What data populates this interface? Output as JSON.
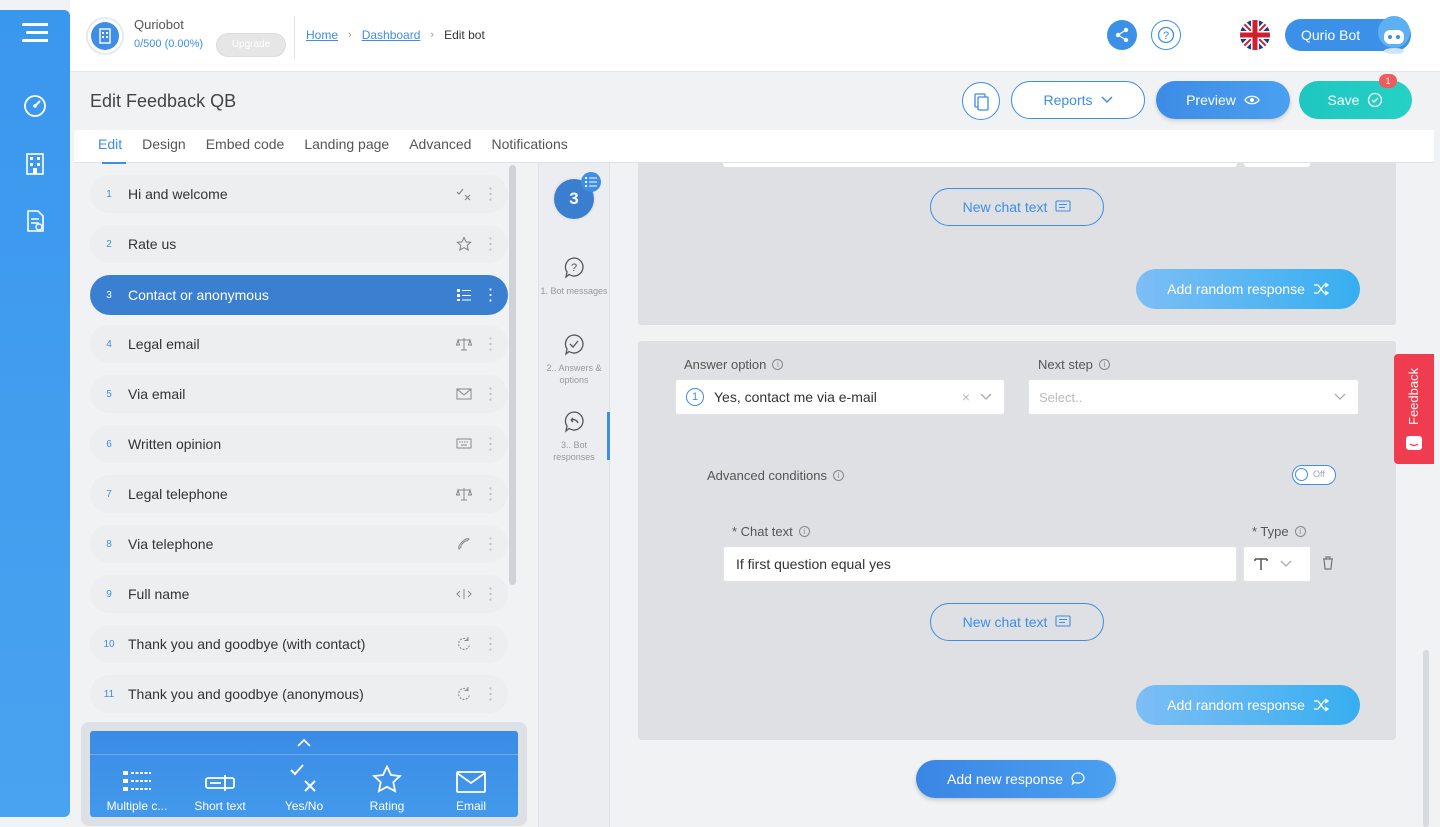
{
  "app": {
    "org_name": "Quriobot",
    "usage": "0/500 (0.00%)",
    "upgrade_label": "Upgrade",
    "breadcrumb": [
      "Home",
      "Dashboard",
      "Edit bot"
    ],
    "user_name": "Qurio Bot"
  },
  "rail": {
    "icons": [
      "menu-icon",
      "dashboard-gauge-icon",
      "building-icon",
      "document-icon"
    ]
  },
  "title_bar": {
    "title": "Edit Feedback QB",
    "reports_label": "Reports",
    "preview_label": "Preview",
    "save_label": "Save",
    "save_badge": "1"
  },
  "tabs": [
    {
      "label": "Edit",
      "active": true
    },
    {
      "label": "Design",
      "active": false
    },
    {
      "label": "Embed code",
      "active": false
    },
    {
      "label": "Landing page",
      "active": false
    },
    {
      "label": "Advanced",
      "active": false
    },
    {
      "label": "Notifications",
      "active": false
    }
  ],
  "steps": [
    {
      "num": "1",
      "label": "Hi and welcome",
      "icon": "yes-no-icon",
      "active": false
    },
    {
      "num": "2",
      "label": "Rate us",
      "icon": "star-icon",
      "active": false
    },
    {
      "num": "3",
      "label": "Contact or anonymous",
      "icon": "list-icon",
      "active": true
    },
    {
      "num": "4",
      "label": "Legal email",
      "icon": "scale-icon",
      "active": false
    },
    {
      "num": "5",
      "label": "Via email",
      "icon": "envelope-icon",
      "active": false
    },
    {
      "num": "6",
      "label": "Written opinion",
      "icon": "keyboard-icon",
      "active": false
    },
    {
      "num": "7",
      "label": "Legal telephone",
      "icon": "scale-icon",
      "active": false
    },
    {
      "num": "8",
      "label": "Via telephone",
      "icon": "phone-icon",
      "active": false
    },
    {
      "num": "9",
      "label": "Full name",
      "icon": "text-cursor-icon",
      "active": false
    },
    {
      "num": "10",
      "label": "Thank you and goodbye (with contact)",
      "icon": "loop-icon",
      "active": false
    },
    {
      "num": "11",
      "label": "Thank you and goodbye (anonymous)",
      "icon": "loop-icon",
      "active": false
    }
  ],
  "toolbox": [
    {
      "label": "Multiple c...",
      "icon": "multiple-choice-icon"
    },
    {
      "label": "Short text",
      "icon": "short-text-icon"
    },
    {
      "label": "Yes/No",
      "icon": "yes-no-icon"
    },
    {
      "label": "Rating",
      "icon": "star-icon"
    },
    {
      "label": "Email",
      "icon": "envelope-icon"
    }
  ],
  "subnav": {
    "step_number": "3",
    "items": [
      {
        "label": "1. Bot messages",
        "icon": "bot-question-icon"
      },
      {
        "label": "2.. Answers & options",
        "icon": "check-bubble-icon"
      },
      {
        "label": "3.. Bot responses",
        "icon": "reply-bubble-icon"
      }
    ]
  },
  "responses": {
    "new_chat_text_label": "New chat text",
    "add_random_response_label": "Add random response",
    "answer_option_label": "Answer option",
    "answer_option_value": "Yes, contact me via e-mail",
    "answer_option_number": "1",
    "next_step_label": "Next step",
    "next_step_placeholder": "Select..",
    "advanced_conditions_label": "Advanced conditions",
    "toggle_state": "Off",
    "chat_text_label": "* Chat text",
    "chat_text_value": "If first question equal yes",
    "type_label": "* Type",
    "add_new_response_label": "Add new response"
  },
  "feedback_tab": {
    "label": "Feedback"
  },
  "colors": {
    "primary": "#3e8de6",
    "save": "#1fc6c2",
    "feedback": "#ef3d4f"
  }
}
